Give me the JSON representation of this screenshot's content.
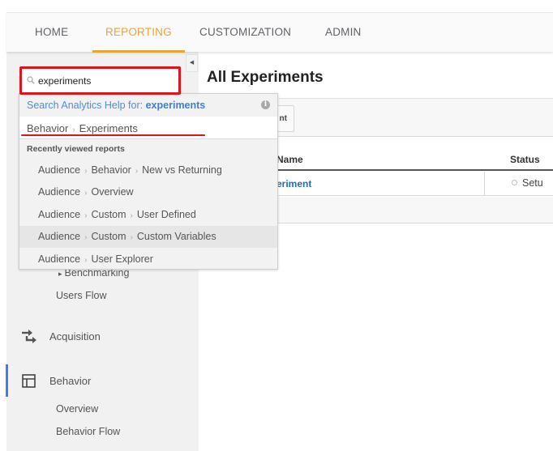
{
  "nav": {
    "tabs": [
      {
        "label": "HOME",
        "active": false
      },
      {
        "label": "REPORTING",
        "active": true
      },
      {
        "label": "CUSTOMIZATION",
        "active": false
      },
      {
        "label": "ADMIN",
        "active": false
      }
    ],
    "accent_color": "#f4a02b"
  },
  "search": {
    "value": "experiments",
    "placeholder": "",
    "highlight_color": "#e0141b"
  },
  "dropdown": {
    "help_prefix": "Search Analytics Help for: ",
    "help_query": "experiments",
    "match": {
      "parts": [
        "Behavior",
        "Experiments"
      ]
    },
    "recent_label": "Recently viewed reports",
    "recent": [
      {
        "parts": [
          "Audience",
          "Behavior",
          "New vs Returning"
        ]
      },
      {
        "parts": [
          "Audience",
          "Overview"
        ]
      },
      {
        "parts": [
          "Audience",
          "Custom",
          "User Defined"
        ]
      },
      {
        "parts": [
          "Audience",
          "Custom",
          "Custom Variables"
        ],
        "hovered": true
      },
      {
        "parts": [
          "Audience",
          "User Explorer"
        ]
      }
    ],
    "separator": "›"
  },
  "sidebar": {
    "collapse_icon": "◀",
    "items": [
      {
        "label": "Benchmarking",
        "prefix": "▸"
      },
      {
        "label": "Users Flow"
      }
    ],
    "sections": [
      {
        "label": "Acquisition",
        "icon": "acquisition-arrows-icon",
        "active": false
      },
      {
        "label": "Behavior",
        "icon": "behavior-layout-icon",
        "active": true
      }
    ],
    "behavior_items": [
      {
        "label": "Overview"
      },
      {
        "label": "Behavior Flow"
      }
    ],
    "active_color": "#3f7fe6"
  },
  "main": {
    "title": "All Experiments",
    "create_button_visible_text": "nt",
    "table": {
      "headers": [
        "Name",
        "Status"
      ],
      "header_name_visible": "Name",
      "rows": [
        {
          "name_visible": "eriment",
          "status_visible": "Setu"
        }
      ]
    }
  }
}
